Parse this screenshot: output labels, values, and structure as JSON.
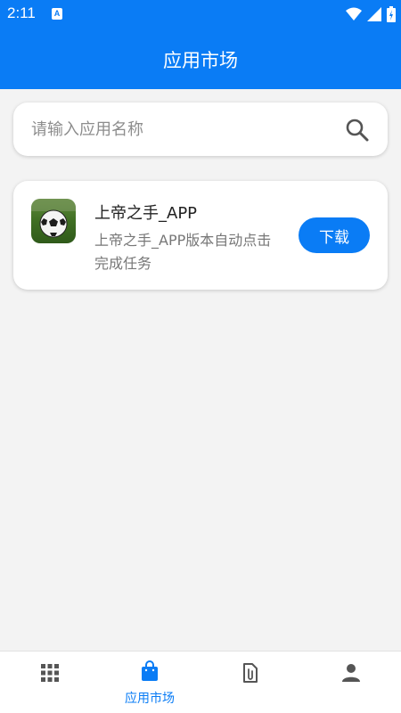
{
  "status_bar": {
    "time": "2:11",
    "notification_badge": "A"
  },
  "app_bar": {
    "title": "应用市场"
  },
  "search": {
    "placeholder": "请输入应用名称",
    "value": "",
    "icon": "search-icon"
  },
  "apps": [
    {
      "name": "上帝之手_APP",
      "description": "上帝之手_APP版本自动点击完成任务",
      "icon": "soccer-ball-icon",
      "action_label": "下载"
    }
  ],
  "tab_bar": {
    "active_color": "#0a7cf5",
    "items": [
      {
        "icon": "grid-icon",
        "label": ""
      },
      {
        "icon": "shopping-bag-icon",
        "label": "应用市场",
        "active": true
      },
      {
        "icon": "attachment-document-icon",
        "label": ""
      },
      {
        "icon": "person-icon",
        "label": ""
      }
    ]
  },
  "colors": {
    "primary": "#0a7cf5",
    "background": "#f3f3f3"
  }
}
